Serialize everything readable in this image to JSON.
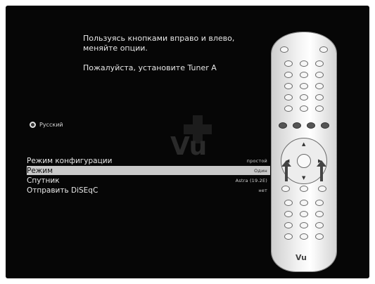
{
  "instructions": {
    "line1": "Пользуясь кнопками вправо и влево,",
    "line2": "меняйте опции.",
    "line3": "Пожалуйста, установите Tuner A"
  },
  "language": {
    "label": "Русский"
  },
  "logo": {
    "text": "Vu"
  },
  "menu": {
    "items": [
      {
        "label": "Режим конфигурации",
        "value": "простой"
      },
      {
        "label": "Режим",
        "value": "Один"
      },
      {
        "label": "Спутник",
        "value": "Astra (19.2E)"
      },
      {
        "label": "Отправить DiSEqC",
        "value": "нет"
      }
    ],
    "selected_index": 1
  },
  "remote": {
    "brand": "Vu"
  },
  "colors": {
    "background": "#060606",
    "highlight": "#c9c9c9",
    "text": "#e8e8e8"
  }
}
